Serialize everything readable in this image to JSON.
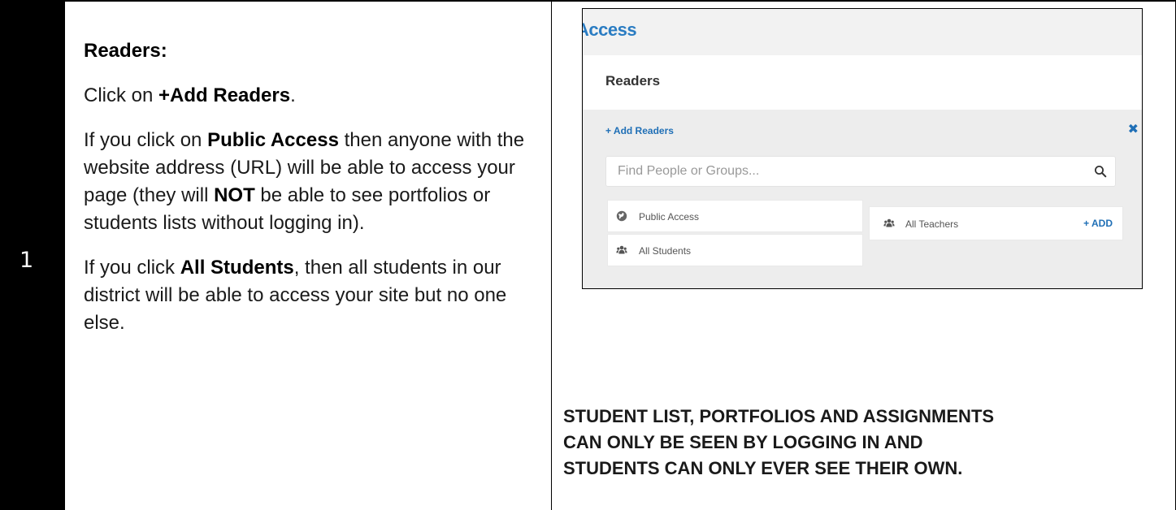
{
  "step": {
    "number": "1"
  },
  "instructions": {
    "heading": "Readers:",
    "click_prefix": "Click on ",
    "click_bold": "+Add Readers",
    "click_suffix": ".",
    "public_prefix": "If you click on ",
    "public_bold": "Public Access",
    "public_middle": " then anyone with the website address (URL) will be able to access your page (they will ",
    "public_not": "NOT",
    "public_suffix": " be able to see portfolios or students lists without logging in).",
    "students_prefix": "If you click ",
    "students_bold": "All Students",
    "students_suffix": ", then all students in our district will be able to access your site but no one else."
  },
  "screenshot": {
    "title": "Access",
    "readers_title": "Readers",
    "add_readers_label": "+ Add Readers",
    "close_icon": "close-icon",
    "search": {
      "placeholder": "Find People or Groups...",
      "value": ""
    },
    "options": {
      "public_access": {
        "label": "Public Access",
        "icon": "globe-icon"
      },
      "all_students": {
        "label": "All Students",
        "icon": "group-icon"
      },
      "all_teachers": {
        "label": "All Teachers",
        "icon": "group-icon",
        "action": "+ ADD"
      }
    },
    "colors": {
      "accent": "#1f6fb6",
      "title": "#2a7cc2",
      "panel_bg": "#ededed"
    }
  },
  "caption": {
    "line1": "STUDENT LIST, PORTFOLIOS AND ASSIGNMENTS",
    "line2": "CAN ONLY BE SEEN BY LOGGING IN AND",
    "line3": "STUDENTS CAN ONLY EVER SEE THEIR OWN."
  }
}
